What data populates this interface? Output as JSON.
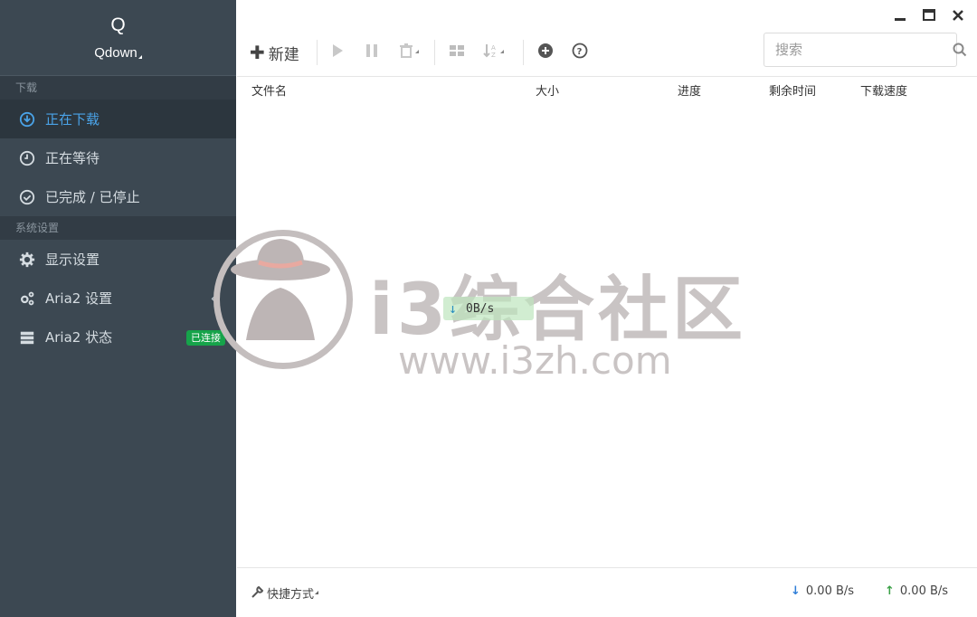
{
  "app": {
    "logo_letter": "Q",
    "name": "Qdown"
  },
  "sidebar": {
    "section_download": "下载",
    "downloading": "正在下载",
    "waiting": "正在等待",
    "stopped": "已完成 / 已停止",
    "section_settings": "系统设置",
    "display_settings": "显示设置",
    "aria2_settings": "Aria2 设置",
    "aria2_status": "Aria2 状态",
    "connected_badge": "已连接",
    "chevron": "‹"
  },
  "toolbar": {
    "new_label": "新建",
    "search_placeholder": "搜索"
  },
  "columns": {
    "filename": "文件名",
    "size": "大小",
    "progress": "进度",
    "remaining": "剩余时间",
    "speed": "下载速度"
  },
  "overlay": {
    "watermark_text": "i3综合社区",
    "watermark_url": "www.i3zh.com",
    "speed": "0B/s"
  },
  "footer": {
    "shortcut_label": "快捷方式",
    "download_speed": "0.00 B/s",
    "upload_speed": "0.00 B/s"
  },
  "colors": {
    "sidebar_bg": "#3c4852",
    "active_accent": "#4aa3e8",
    "badge_green": "#16a34a",
    "download_arrow": "#2f7ed8",
    "upload_arrow": "#3aa046"
  }
}
